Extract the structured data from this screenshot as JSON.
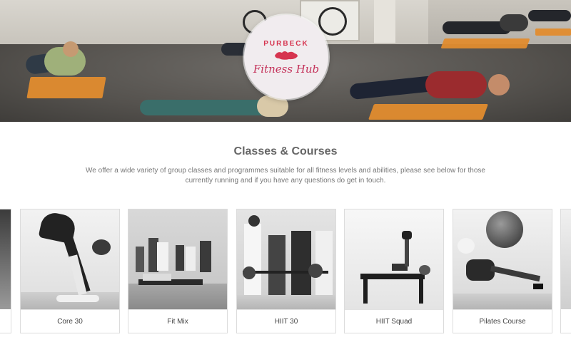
{
  "hero": {
    "logo": {
      "top_text": "PURBECK",
      "script_text": "Fitness Hub",
      "accent_color": "#d6344f"
    }
  },
  "intro": {
    "title": "Classes & Courses",
    "description": "We offer a wide variety of group classes and programmes suitable for all fitness levels and abilities, please see below for those currently running and if you have any questions do get in touch."
  },
  "classes": [
    {
      "label": "Core 30"
    },
    {
      "label": "Fit Mix"
    },
    {
      "label": "HIIT 30"
    },
    {
      "label": "HIIT Squad"
    },
    {
      "label": "Pilates Course"
    }
  ]
}
